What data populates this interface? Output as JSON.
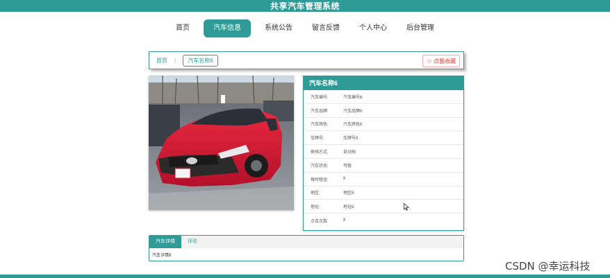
{
  "header": {
    "title": "共享汽车管理系统"
  },
  "nav": {
    "items": [
      {
        "label": "首页"
      },
      {
        "label": "汽车信息",
        "active": true
      },
      {
        "label": "系统公告"
      },
      {
        "label": "留言反馈"
      },
      {
        "label": "个人中心"
      },
      {
        "label": "后台管理"
      }
    ]
  },
  "breadcrumb": {
    "home": "首页",
    "separator": "/",
    "current": "汽车名称6"
  },
  "favorite": {
    "icon": "star-outline-icon",
    "label": "点我收藏"
  },
  "photo": {
    "description_icon": "car-photo",
    "alt": "汽车图片"
  },
  "detail": {
    "title": "汽车名称6",
    "rows": [
      {
        "key": "汽车编号:",
        "value": "汽车编号6"
      },
      {
        "key": "汽车品牌:",
        "value": "汽车品牌6"
      },
      {
        "key": "汽车颜色:",
        "value": "汽车颜色6"
      },
      {
        "key": "车牌号:",
        "value": "车牌号6"
      },
      {
        "key": "换挡方式:",
        "value": "自动挡"
      },
      {
        "key": "汽车状态:",
        "value": "可租"
      },
      {
        "key": "每时租金:",
        "value": "6"
      },
      {
        "key": "地区:",
        "value": "地区6"
      },
      {
        "key": "地址:",
        "value": "地址6"
      },
      {
        "key": "点击次数:",
        "value": "8"
      }
    ]
  },
  "tabs": {
    "items": [
      {
        "label": "汽车详情",
        "active": true
      },
      {
        "label": "评论"
      }
    ],
    "content": "汽车详情6"
  },
  "watermark": "CSDN @幸运科技",
  "colors": {
    "primary": "#2e9b96",
    "favorite": "#e03b3b"
  }
}
